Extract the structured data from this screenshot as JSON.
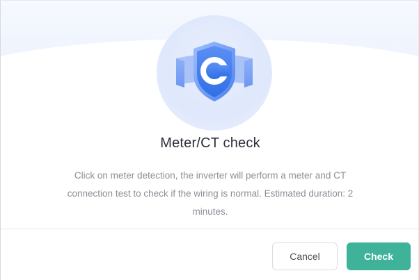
{
  "dialog": {
    "title": "Meter/CT check",
    "description": "Click on meter detection, the inverter will perform a meter and CT connection test to check if the wiring is normal. Estimated duration: 2 minutes.",
    "hero_icon": "shield-c-icon",
    "buttons": {
      "cancel_label": "Cancel",
      "check_label": "Check"
    }
  },
  "colors": {
    "accent": "#3fb39a",
    "icon_blue": "#3c7cf0",
    "title_text": "#2b2f3a",
    "description_text": "#8c8f96"
  }
}
